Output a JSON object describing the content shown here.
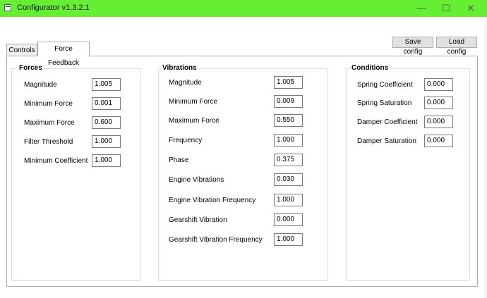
{
  "window": {
    "title": "Configurator v1.3.2.1",
    "minimize_glyph": "—",
    "maximize_glyph": "☐",
    "close_glyph": "✕"
  },
  "toolbar": {
    "save_label": "Save config",
    "load_label": "Load config"
  },
  "tabs": [
    "Controls",
    "Force Feedback"
  ],
  "forces": {
    "title": "Forces",
    "fields": [
      {
        "label": "Magnitude",
        "value": "1.005"
      },
      {
        "label": "Minimum Force",
        "value": "0.001"
      },
      {
        "label": "Maximum Force",
        "value": "0.600"
      },
      {
        "label": "Filter Threshold",
        "value": "1.000"
      },
      {
        "label": "Minimum Coefficient",
        "value": "1.000"
      }
    ]
  },
  "vibrations": {
    "title": "Vibrations",
    "fields": [
      {
        "label": "Magnitude",
        "value": "1.005"
      },
      {
        "label": "Minimum Force",
        "value": "0.009"
      },
      {
        "label": "Maximum Force",
        "value": "0.550"
      },
      {
        "label": "Frequency",
        "value": "1.000"
      },
      {
        "label": "Phase",
        "value": "0.375"
      },
      {
        "label": "Engine Vibrations",
        "value": "0.030"
      },
      {
        "label": "Engine Vibration Frequency",
        "value": "1.000"
      },
      {
        "label": "Gearshift Vibration",
        "value": "0.000"
      },
      {
        "label": "Gearshift Vibration Frequency",
        "value": "1.000"
      }
    ]
  },
  "conditions": {
    "title": "Conditions",
    "fields": [
      {
        "label": "Spring Coefficient",
        "value": "0.000"
      },
      {
        "label": "Spring Saturation",
        "value": "0.000"
      },
      {
        "label": "Damper Coefficient",
        "value": "0.000"
      },
      {
        "label": "Damper Saturation",
        "value": "0.000"
      }
    ]
  }
}
